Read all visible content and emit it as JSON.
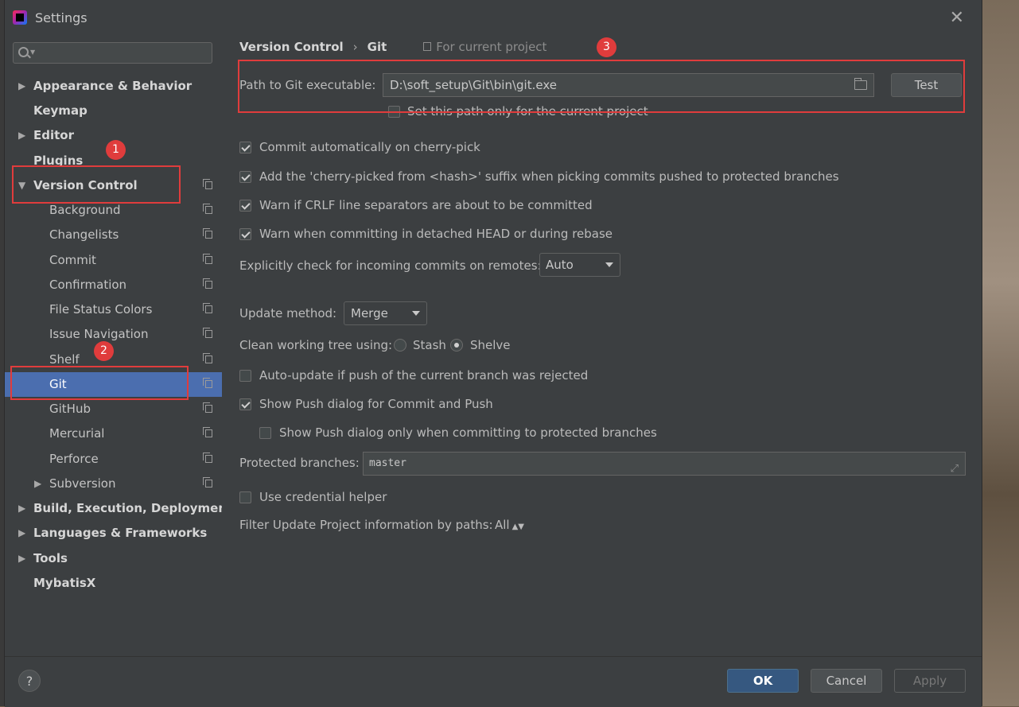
{
  "window": {
    "title": "Settings"
  },
  "sidebar": {
    "items": [
      {
        "label": "Appearance & Behavior"
      },
      {
        "label": "Keymap"
      },
      {
        "label": "Editor"
      },
      {
        "label": "Plugins"
      },
      {
        "label": "Version Control"
      },
      {
        "label": "Background"
      },
      {
        "label": "Changelists"
      },
      {
        "label": "Commit"
      },
      {
        "label": "Confirmation"
      },
      {
        "label": "File Status Colors"
      },
      {
        "label": "Issue Navigation"
      },
      {
        "label": "Shelf"
      },
      {
        "label": "Git"
      },
      {
        "label": "GitHub"
      },
      {
        "label": "Mercurial"
      },
      {
        "label": "Perforce"
      },
      {
        "label": "Subversion"
      },
      {
        "label": "Build, Execution, Deployment"
      },
      {
        "label": "Languages & Frameworks"
      },
      {
        "label": "Tools"
      },
      {
        "label": "MybatisX"
      }
    ],
    "selected": "Git"
  },
  "breadcrumb": {
    "parent": "Version Control",
    "separator": "›",
    "current": "Git",
    "scope": "For current project"
  },
  "git": {
    "path_label": "Path to Git executable:",
    "path_value": "D:\\soft_setup\\Git\\bin\\git.exe",
    "test_button": "Test",
    "path_only_project": "Set this path only for the current project",
    "commit_auto": "Commit automatically on cherry-pick",
    "cherry_suffix": "Add the 'cherry-picked from <hash>' suffix when picking commits pushed to protected branches",
    "warn_crlf": "Warn if CRLF line separators are about to be committed",
    "warn_detached": "Warn when committing in detached HEAD or during rebase",
    "incoming_label": "Explicitly check for incoming commits on remotes:",
    "incoming_value": "Auto",
    "update_label": "Update method:",
    "update_value": "Merge",
    "clean_label": "Clean working tree using:",
    "stash": "Stash",
    "shelve": "Shelve",
    "auto_update": "Auto-update if push of the current branch was rejected",
    "show_push": "Show Push dialog for Commit and Push",
    "show_push_protected": "Show Push dialog only when committing to protected branches",
    "protected_label": "Protected branches:",
    "protected_value": "master",
    "credential": "Use credential helper",
    "filter_label": "Filter Update Project information by paths:",
    "filter_value": "All"
  },
  "footer": {
    "help": "?",
    "ok": "OK",
    "cancel": "Cancel",
    "apply": "Apply"
  },
  "annotations": {
    "one": "1",
    "two": "2",
    "three": "3"
  },
  "colors": {
    "selection": "#4b6eaf",
    "annotation": "#e03c3c",
    "primary_button": "#365880"
  }
}
